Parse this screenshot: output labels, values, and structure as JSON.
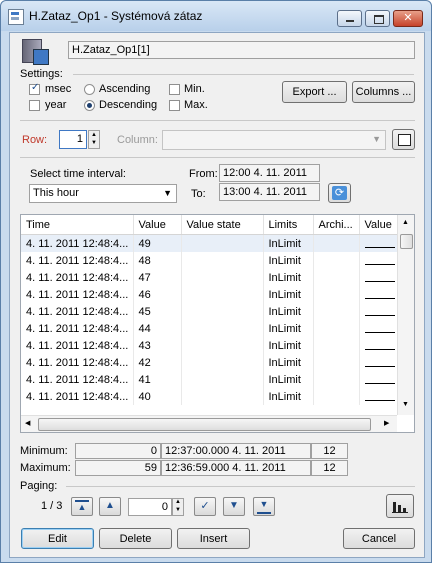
{
  "window": {
    "title": "H.Zataz_Op1 - Systémová zátaz"
  },
  "header": {
    "object_name": "H.Zataz_Op1[1]"
  },
  "settings": {
    "label": "Settings:",
    "msec": "msec",
    "year": "year",
    "ascending": "Ascending",
    "descending": "Descending",
    "min": "Min.",
    "max": "Max.",
    "msec_checked": true,
    "year_checked": false,
    "descending_selected": true,
    "min_checked": false,
    "max_checked": false
  },
  "buttons": {
    "export": "Export ...",
    "columns": "Columns ..."
  },
  "row": {
    "label": "Row:",
    "value": "1",
    "column_label": "Column:",
    "column_value": ""
  },
  "interval": {
    "label": "Select time interval:",
    "selected": "This hour",
    "from_label": "From:",
    "from_value": "12:00 4. 11. 2011",
    "to_label": "To:",
    "to_value": "13:00 4. 11. 2011"
  },
  "table": {
    "columns": [
      "Time",
      "Value",
      "Value state",
      "Limits",
      "Archi...",
      "Value"
    ],
    "rows": [
      {
        "time": "4. 11. 2011 12:48:4...",
        "value": "49",
        "limits": "InLimit"
      },
      {
        "time": "4. 11. 2011 12:48:4...",
        "value": "48",
        "limits": "InLimit"
      },
      {
        "time": "4. 11. 2011 12:48:4...",
        "value": "47",
        "limits": "InLimit"
      },
      {
        "time": "4. 11. 2011 12:48:4...",
        "value": "46",
        "limits": "InLimit"
      },
      {
        "time": "4. 11. 2011 12:48:4...",
        "value": "45",
        "limits": "InLimit"
      },
      {
        "time": "4. 11. 2011 12:48:4...",
        "value": "44",
        "limits": "InLimit"
      },
      {
        "time": "4. 11. 2011 12:48:4...",
        "value": "43",
        "limits": "InLimit"
      },
      {
        "time": "4. 11. 2011 12:48:4...",
        "value": "42",
        "limits": "InLimit"
      },
      {
        "time": "4. 11. 2011 12:48:4...",
        "value": "41",
        "limits": "InLimit"
      },
      {
        "time": "4. 11. 2011 12:48:4...",
        "value": "40",
        "limits": "InLimit"
      }
    ]
  },
  "stats": {
    "minimum_label": "Minimum:",
    "minimum_value": "0",
    "minimum_time": "12:37:00.000 4. 11. 2011",
    "minimum_count": "12",
    "maximum_label": "Maximum:",
    "maximum_value": "59",
    "maximum_time": "12:36:59.000 4. 11. 2011",
    "maximum_count": "12"
  },
  "paging": {
    "label": "Paging:",
    "page": "1 / 3",
    "offset": "0"
  },
  "actions": {
    "edit": "Edit",
    "delete": "Delete",
    "insert": "Insert",
    "cancel": "Cancel"
  },
  "colors": {
    "accent": "#3f78c4",
    "row_label": "#c0392b"
  }
}
